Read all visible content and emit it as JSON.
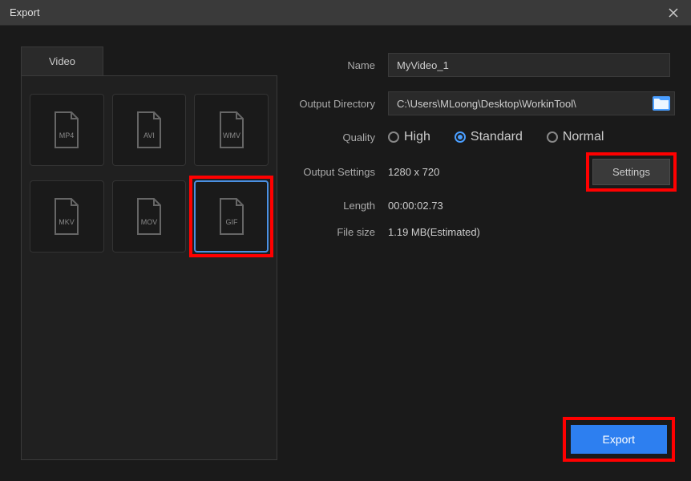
{
  "window": {
    "title": "Export"
  },
  "tabs": {
    "video": "Video"
  },
  "formats": [
    {
      "label": "MP4",
      "selected": false
    },
    {
      "label": "AVI",
      "selected": false
    },
    {
      "label": "WMV",
      "selected": false
    },
    {
      "label": "MKV",
      "selected": false
    },
    {
      "label": "MOV",
      "selected": false
    },
    {
      "label": "GIF",
      "selected": true
    }
  ],
  "form": {
    "name_label": "Name",
    "name_value": "MyVideo_1",
    "output_dir_label": "Output Directory",
    "output_dir_value": "C:\\Users\\MLoong\\Desktop\\WorkinTool\\",
    "quality_label": "Quality",
    "quality_options": {
      "high": "High",
      "standard": "Standard",
      "normal": "Normal"
    },
    "quality_selected": "standard",
    "output_settings_label": "Output Settings",
    "output_settings_value": "1280 x 720",
    "settings_button": "Settings",
    "length_label": "Length",
    "length_value": "00:00:02.73",
    "filesize_label": "File size",
    "filesize_value": "1.19 MB(Estimated)"
  },
  "buttons": {
    "export": "Export"
  }
}
